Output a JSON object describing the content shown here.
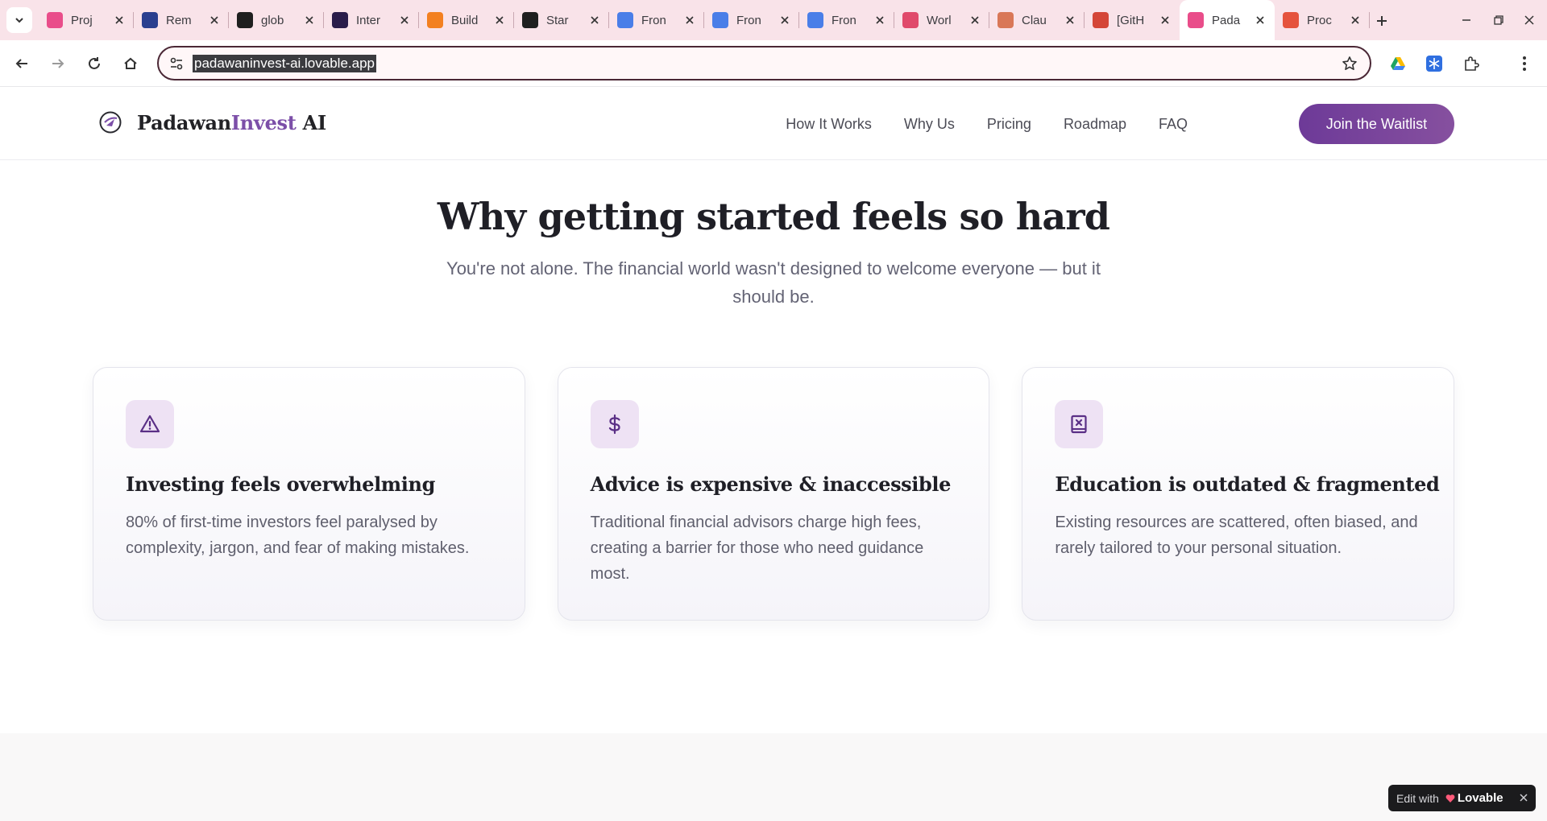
{
  "browser": {
    "tabs": [
      {
        "title": "Proj",
        "favicon": "lovable-heart-icon",
        "color": "#e94d8a"
      },
      {
        "title": "Rem",
        "favicon": "france-flag-icon",
        "color": "#2a3f8f"
      },
      {
        "title": "glob",
        "favicon": "github-icon",
        "color": "#1f1f1f"
      },
      {
        "title": "Inter",
        "favicon": "square-app-icon",
        "color": "#2a1c4a"
      },
      {
        "title": "Build",
        "favicon": "cloudflare-icon",
        "color": "#f38020"
      },
      {
        "title": "Star",
        "favicon": "openai-icon",
        "color": "#1f1f1f"
      },
      {
        "title": "Fron",
        "favicon": "google-docs-icon",
        "color": "#4a7ee8"
      },
      {
        "title": "Fron",
        "favicon": "google-docs-icon",
        "color": "#4a7ee8"
      },
      {
        "title": "Fron",
        "favicon": "google-docs-icon",
        "color": "#4a7ee8"
      },
      {
        "title": "Worl",
        "favicon": "workflow-icon",
        "color": "#e04a6b"
      },
      {
        "title": "Clau",
        "favicon": "claude-icon",
        "color": "#d97757"
      },
      {
        "title": "[GitH",
        "favicon": "gmail-icon",
        "color": "#d44638"
      },
      {
        "title": "Pada",
        "favicon": "lovable-heart-icon",
        "color": "#e94d8a",
        "active": true
      },
      {
        "title": "Proc",
        "favicon": "producthunt-icon",
        "color": "#e5533d"
      }
    ],
    "url": "padawaninvest-ai.lovable.app"
  },
  "site": {
    "brand": {
      "name_part1": "Padawan",
      "name_part2": "Invest",
      "name_part3": " AI"
    },
    "nav": [
      "How It Works",
      "Why Us",
      "Pricing",
      "Roadmap",
      "FAQ"
    ],
    "cta_label": "Join the Waitlist",
    "accent_color": "#7c4fa8"
  },
  "section": {
    "title": "Why getting started feels so hard",
    "subtitle": "You're not alone. The financial world wasn't designed to welcome everyone — but it should be.",
    "cards": [
      {
        "icon": "warning-triangle-icon",
        "title": "Investing feels overwhelming",
        "text": "80% of first-time investors feel paralysed by complexity, jargon, and fear of making mistakes."
      },
      {
        "icon": "dollar-sign-icon",
        "title": "Advice is expensive & inaccessible",
        "text": "Traditional financial advisors charge high fees, creating a barrier for those who need guidance most."
      },
      {
        "icon": "book-x-icon",
        "title": "Education is outdated & fragmented",
        "text": "Existing resources are scattered, often biased, and rarely tailored to your personal situation."
      }
    ]
  },
  "badge": {
    "prefix": "Edit with",
    "brand": "Lovable"
  }
}
